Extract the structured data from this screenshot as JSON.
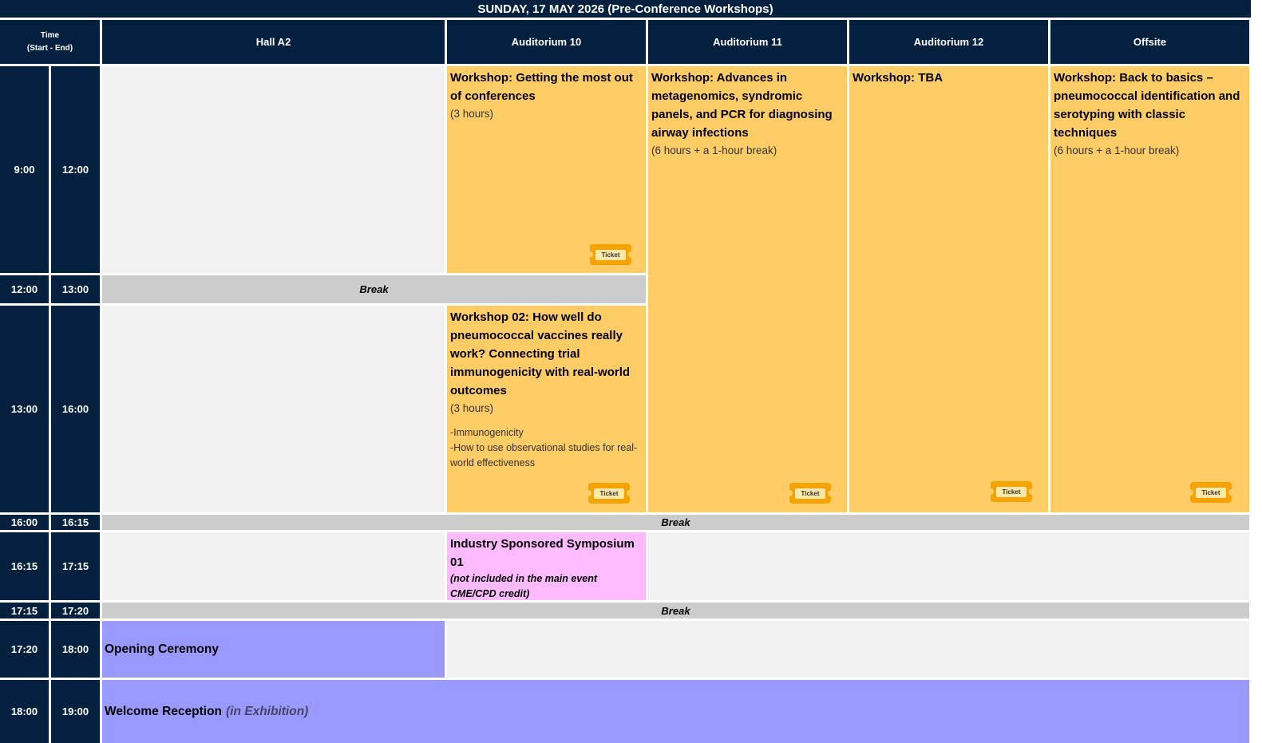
{
  "title": "SUNDAY, 17 MAY 2026 (Pre-Conference Workshops)",
  "header": {
    "time_label": "Time",
    "time_sub": "(Start  -  End)",
    "rooms": [
      "Hall A2",
      "Auditorium 10",
      "Auditorium 11",
      "Auditorium 12",
      "Offsite"
    ]
  },
  "times": [
    {
      "start": "9:00",
      "end": "12:00"
    },
    {
      "start": "12:00",
      "end": "13:00"
    },
    {
      "start": "13:00",
      "end": "16:00"
    },
    {
      "start": "16:00",
      "end": "16:15"
    },
    {
      "start": "16:15",
      "end": "17:15"
    },
    {
      "start": "17:15",
      "end": "17:20"
    },
    {
      "start": "17:20",
      "end": "18:00"
    },
    {
      "start": "18:00",
      "end": "19:00"
    }
  ],
  "break_label": "Break",
  "ticket_label": "Ticket",
  "workshops": {
    "aud10_morning": {
      "title": "Workshop: Getting the most out of conferences",
      "duration": "(3 hours)"
    },
    "aud11": {
      "title": "Workshop: Advances in metagenomics, syndromic panels, and PCR for diagnosing airway infections",
      "duration": "(6 hours + a 1-hour break)"
    },
    "aud12": {
      "title": "Workshop: TBA"
    },
    "offsite": {
      "title": "Workshop: Back to basics – pneumococcal identification and serotyping with classic techniques",
      "duration": "(6 hours + a 1-hour break)"
    },
    "aud10_afternoon": {
      "title": "Workshop 02: How well do pneumococcal vaccines really work? Connecting trial immunogenicity with real-world outcomes",
      "duration": "(3 hours)",
      "bullets": [
        "-Immunogenicity",
        "-How to use observational studies for real-world effectiveness"
      ]
    }
  },
  "symposium": {
    "title": "Industry Sponsored Symposium 01",
    "note": "(not included in the main event CME/CPD credit)"
  },
  "opening": {
    "title": "Opening Ceremony"
  },
  "reception": {
    "title": "Welcome Reception",
    "sub": "(in Exhibition)"
  },
  "colors": {
    "navy": "#03213f",
    "workshop": "#ffcc66",
    "break": "#cccccc",
    "symposium": "#ffbbff",
    "ceremony": "#9999ff",
    "empty": "#f2f2f2"
  }
}
